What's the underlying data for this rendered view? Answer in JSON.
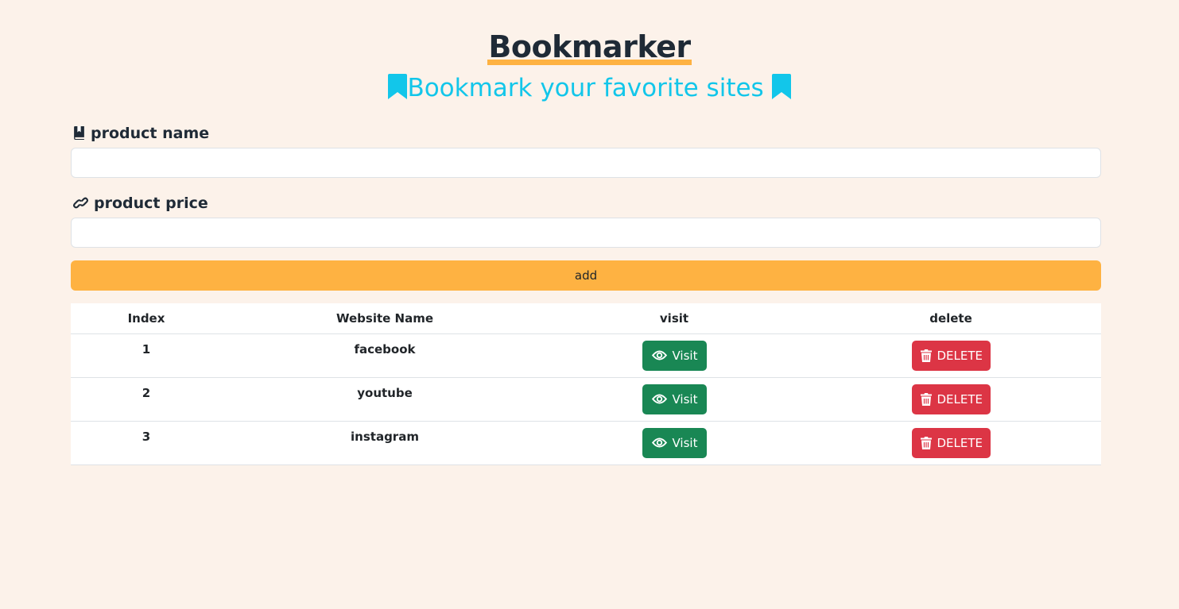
{
  "header": {
    "title": "Bookmarker",
    "subtitle": "Bookmark your favorite sites",
    "subtitle_icon": "bookmark-icon",
    "accent_color": "#feb242",
    "subtitle_color": "#12c6ea"
  },
  "form": {
    "name_label": "product name",
    "name_icon": "book-icon",
    "name_value": "",
    "price_label": "product price",
    "price_icon": "link-icon",
    "price_value": "",
    "add_label": "add"
  },
  "table": {
    "headers": [
      "Index",
      "Website Name",
      "visit",
      "delete"
    ],
    "rows": [
      {
        "index": "1",
        "name": "facebook",
        "visit_label": "Visit",
        "delete_label": "DELETE"
      },
      {
        "index": "2",
        "name": "youtube",
        "visit_label": "Visit",
        "delete_label": "DELETE"
      },
      {
        "index": "3",
        "name": "instagram",
        "visit_label": "Visit",
        "delete_label": "DELETE"
      }
    ],
    "visit_icon": "eye-icon",
    "delete_icon": "trash-icon",
    "visit_color": "#198754",
    "delete_color": "#dc3545"
  }
}
